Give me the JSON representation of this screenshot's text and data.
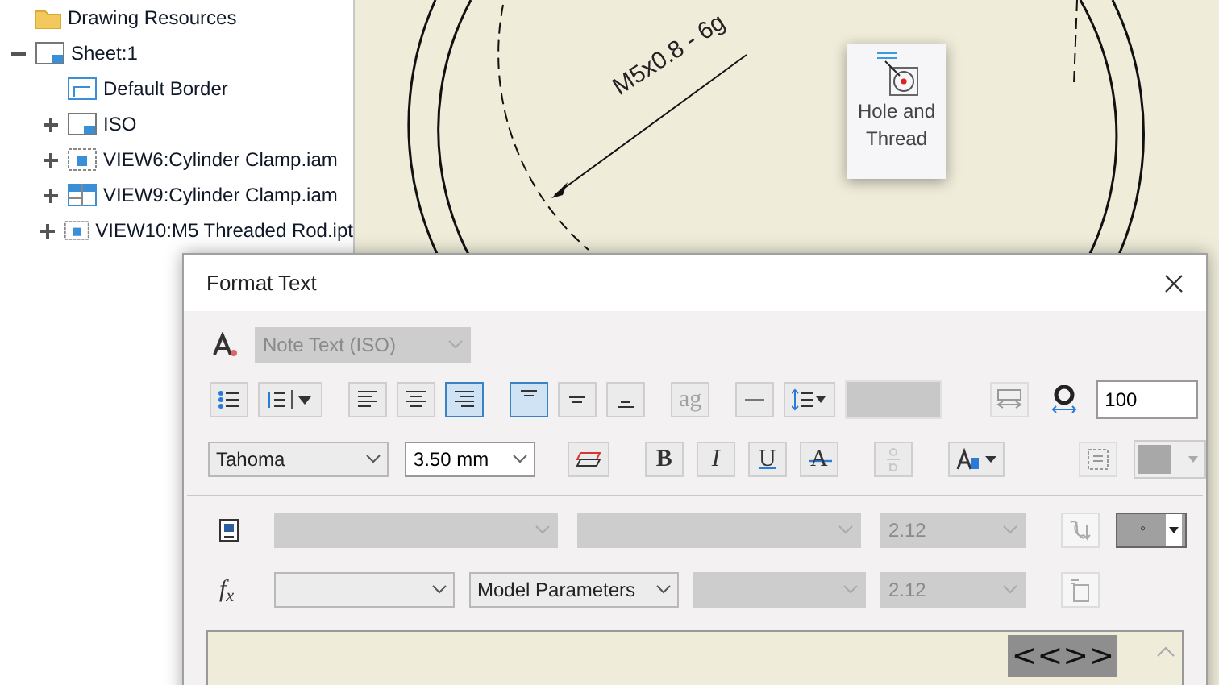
{
  "tree": [
    {
      "label": "Drawing Resources",
      "kind": "folder"
    },
    {
      "label": "Sheet:1",
      "kind": "sheet",
      "expanded": true,
      "children": [
        {
          "label": "Default Border",
          "kind": "border"
        },
        {
          "label": "ISO",
          "kind": "sheet",
          "expanded": false
        },
        {
          "label": "VIEW6:Cylinder Clamp.iam",
          "kind": "view",
          "expanded": false
        },
        {
          "label": "VIEW9:Cylinder Clamp.iam",
          "kind": "section",
          "expanded": false
        },
        {
          "label": "VIEW10:M5 Threaded Rod.ipt",
          "kind": "view",
          "expanded": false
        }
      ]
    }
  ],
  "drawing": {
    "thread_note": "M5x0.8 - 6g"
  },
  "tooltip": {
    "label": "Hole and Thread"
  },
  "dialog": {
    "title": "Format Text",
    "style": {
      "value": "Note Text (ISO)",
      "disabled": true
    },
    "paragraph_tools": [
      {
        "kind": "bullets",
        "selected": false,
        "disabled": false
      },
      {
        "kind": "numbering",
        "selected": false,
        "disabled": false
      },
      {
        "kind": "align-left",
        "selected": false,
        "disabled": false
      },
      {
        "kind": "align-center",
        "selected": false,
        "disabled": false
      },
      {
        "kind": "align-right",
        "selected": true,
        "disabled": false
      },
      {
        "kind": "valign-top",
        "selected": true,
        "disabled": false
      },
      {
        "kind": "valign-middle",
        "selected": false,
        "disabled": false
      },
      {
        "kind": "valign-bottom",
        "selected": false,
        "disabled": false
      },
      {
        "kind": "text",
        "label": "ag",
        "selected": false,
        "disabled": true
      },
      {
        "kind": "rule",
        "selected": false,
        "disabled": false
      },
      {
        "kind": "line-spacing",
        "selected": false,
        "disabled": false
      }
    ],
    "spacing_field": {
      "disabled": true
    },
    "stretch": {
      "disabled": true
    },
    "width_value": "100",
    "font": {
      "value": "Tahoma"
    },
    "size": {
      "value": "3.50 mm"
    },
    "format_tools": [
      {
        "kind": "stack",
        "selected": false,
        "disabled": false
      },
      {
        "kind": "bold",
        "label": "B",
        "selected": false,
        "disabled": false
      },
      {
        "kind": "italic",
        "label": "I",
        "selected": false,
        "disabled": false
      },
      {
        "kind": "underline",
        "label": "U",
        "selected": false,
        "disabled": false
      },
      {
        "kind": "strike",
        "label": "A",
        "selected": false,
        "disabled": false
      },
      {
        "kind": "fraction",
        "selected": false,
        "disabled": true
      },
      {
        "kind": "case",
        "selected": false,
        "disabled": false
      }
    ],
    "frame": {
      "disabled": true
    },
    "color": {
      "disabled": true
    },
    "parameter_row": {
      "selects": [
        {
          "disabled": true
        },
        {
          "disabled": true
        },
        {
          "value": "2.12",
          "disabled": true
        }
      ],
      "insert_disabled": true,
      "symbol": "◦"
    },
    "model_row": {
      "label": "f$_{x}$",
      "selects": [
        {
          "disabled": false
        },
        {
          "value": "Model Parameters",
          "disabled": false
        },
        {
          "disabled": true
        },
        {
          "value": "2.12",
          "disabled": true
        }
      ],
      "insert_disabled": true
    },
    "text_content": "<<>>"
  }
}
